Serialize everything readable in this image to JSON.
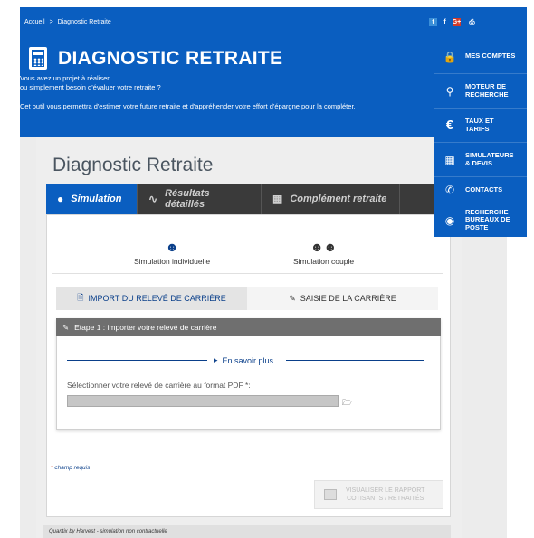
{
  "breadcrumb": {
    "home": "Accueil",
    "separator": ">",
    "current": "Diagnostic Retraite"
  },
  "social": {
    "twitter": "t",
    "facebook": "f",
    "googleplus": "G+",
    "print": "⎙"
  },
  "header": {
    "title": "DIAGNOSTIC RETRAITE",
    "intro_line1": "Vous avez un projet à réaliser...",
    "intro_line2": "ou simplement besoin d'évaluer votre retraite ?",
    "intro_line3": "Cet outil vous permettra d'estimer votre future retraite et d'appréhender votre effort d'épargne pour la compléter."
  },
  "sidemenu": {
    "items": [
      {
        "icon": "lock-icon",
        "label": "MES COMPTES"
      },
      {
        "icon": "search-icon",
        "label": "MOTEUR DE RECHERCHE"
      },
      {
        "icon": "euro-icon",
        "label": "TAUX ET TARIFS"
      },
      {
        "icon": "calculator-icon",
        "label": "SIMULATEURS & DEVIS"
      },
      {
        "icon": "phone-icon",
        "label": "CONTACTS"
      },
      {
        "icon": "location-icon",
        "label": "RECHERCHE BUREAUX DE POSTE"
      }
    ]
  },
  "main": {
    "title": "Diagnostic Retraite",
    "tabs": [
      {
        "label": "Simulation",
        "icon": "user-icon"
      },
      {
        "label": "Résultats détaillés",
        "icon": "chart-icon"
      },
      {
        "label": "Complément retraite",
        "icon": "table-icon"
      }
    ],
    "sim_individual": "Simulation individuelle",
    "sim_couple": "Simulation couple",
    "subtab_import": "IMPORT DU RELEVÉ DE CARRIÈRE",
    "subtab_entry": "SAISIE DE LA CARRIÈRE",
    "step_title": "Etape 1 : importer votre relevé de carrière",
    "more_link": "En savoir plus",
    "file_label": "Sélectionner votre relevé de carrière au format PDF *:",
    "required_star": "*",
    "required_text": "champ requis",
    "report_line1": "VISUALISER LE RAPPORT",
    "report_line2": "COTISANTS / RETRAITÉS",
    "footer": "Quantix by Harvest - simulation non contractuelle"
  },
  "colors": {
    "brand_blue": "#0a5ec0",
    "dark_tab": "#3a3a3a",
    "step_header": "#6f6f6f"
  }
}
